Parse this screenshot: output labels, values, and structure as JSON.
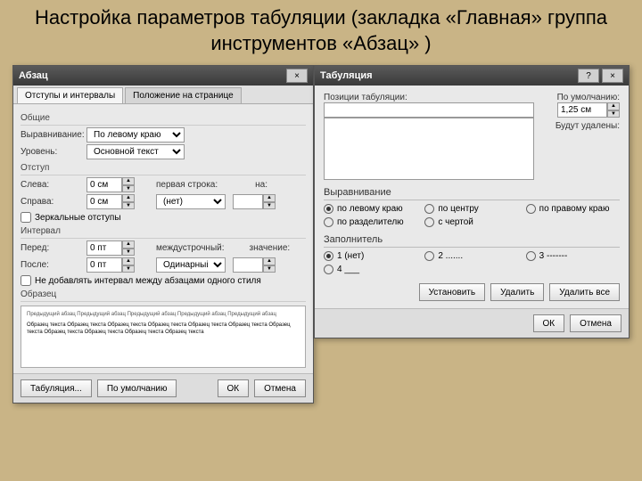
{
  "slide": {
    "title": "Настройка параметров табуляции (закладка «Главная» группа инструментов «Абзац» )"
  },
  "d1": {
    "title": "Абзац",
    "close": "×",
    "tabs": [
      "Отступы и интервалы",
      "Положение на странице"
    ],
    "grp_general": "Общие",
    "align_label": "Выравнивание:",
    "align_value": "По левому краю",
    "level_label": "Уровень:",
    "level_value": "Основной текст",
    "grp_indent": "Отступ",
    "left_label": "Слева:",
    "left_value": "0 см",
    "right_label": "Справа:",
    "right_value": "0 см",
    "first_label": "первая строка:",
    "first_value": "(нет)",
    "on_label": "на:",
    "on_value": "",
    "mirror": "Зеркальные отступы",
    "grp_spacing": "Интервал",
    "before_label": "Перед:",
    "before_value": "0 пт",
    "after_label": "После:",
    "after_value": "0 пт",
    "line_label": "междустрочный:",
    "line_value": "Одинарный",
    "val_label": "значение:",
    "val_value": "",
    "nospace": "Не добавлять интервал между абзацами одного стиля",
    "grp_sample": "Образец",
    "sample1": "Предыдущий абзац Предыдущий абзац Предыдущий абзац Предыдущий абзац Предыдущий абзац",
    "sample2": "Образец текста Образец текста Образец текста Образец текста Образец текста Образец текста Образец текста Образец текста Образец текста Образец текста Образец текста",
    "btn_tabs": "Табуляция...",
    "btn_default": "По умолчанию",
    "btn_ok": "ОК",
    "btn_cancel": "Отмена"
  },
  "d2": {
    "title": "Табуляция",
    "help": "?",
    "close": "×",
    "pos_label": "Позиции табуляции:",
    "pos_value": "",
    "default_label": "По умолчанию:",
    "default_value": "1,25 см",
    "will_delete": "Будут удалены:",
    "sec_align": "Выравнивание",
    "align": {
      "left": "по левому краю",
      "center": "по центру",
      "right": "по правому краю",
      "decimal": "по разделителю",
      "bar": "с чертой"
    },
    "sec_leader": "Заполнитель",
    "leader": {
      "l1": "1 (нет)",
      "l2": "2 .......",
      "l3": "3 -------",
      "l4": "4 ___"
    },
    "btn_set": "Установить",
    "btn_del": "Удалить",
    "btn_delall": "Удалить все",
    "btn_ok": "ОК",
    "btn_cancel": "Отмена"
  }
}
